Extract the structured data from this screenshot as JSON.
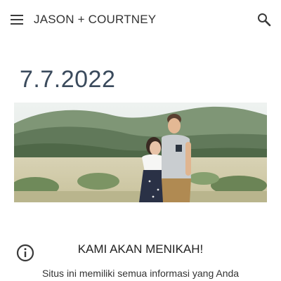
{
  "header": {
    "title": "JASON + COURTNEY",
    "menu_icon": "hamburger-menu-icon",
    "search_icon": "search-icon"
  },
  "main": {
    "date": "7.7.2022",
    "hero_image_alt": "Couple embracing in a grassy field",
    "announcement": "KAMI AKAN MENIKAH!",
    "description": "Situs ini memiliki semua informasi yang Anda"
  },
  "fab": {
    "info_icon": "info-icon"
  },
  "colors": {
    "title_text": "#333333",
    "date_text": "#3a4a5c",
    "icon": "#3a3a3a"
  }
}
